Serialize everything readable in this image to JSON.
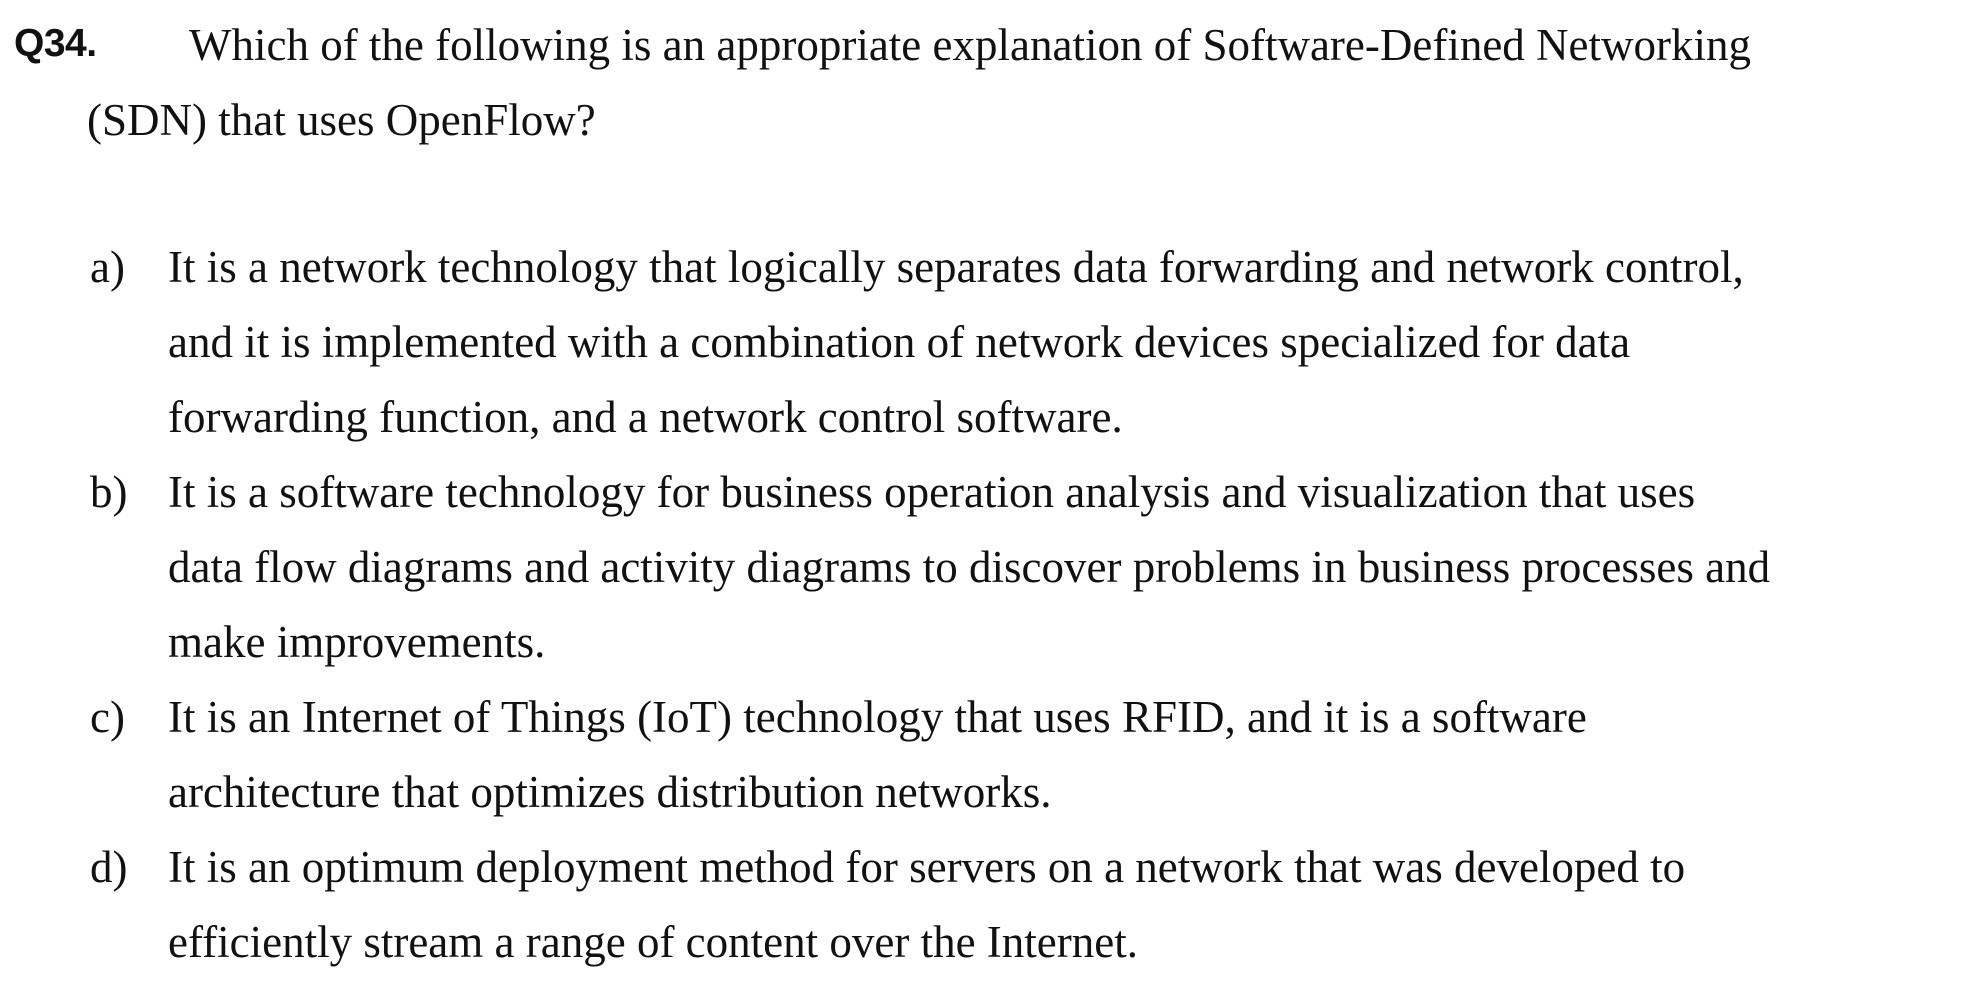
{
  "question": {
    "number": "Q34.",
    "line1": "Which of the following is an appropriate explanation of Software-Defined Networking",
    "line2": "(SDN) that uses OpenFlow?"
  },
  "options": [
    {
      "label": "a)",
      "lines": [
        "It is a network technology that logically separates data forwarding and network control,",
        "and it is implemented with a combination of network devices specialized for data",
        "forwarding function, and a network control software."
      ]
    },
    {
      "label": "b)",
      "lines": [
        "It is a software technology for business operation analysis and visualization that uses",
        "data flow diagrams and activity diagrams to discover problems in business processes and",
        "make improvements."
      ]
    },
    {
      "label": "c)",
      "lines": [
        "It is an Internet of Things (IoT) technology that uses RFID, and it is a software",
        "architecture that optimizes distribution networks."
      ]
    },
    {
      "label": "d)",
      "lines": [
        "It is an optimum deployment method for servers on a network that was developed to",
        "efficiently stream a range of content over the Internet."
      ]
    }
  ]
}
